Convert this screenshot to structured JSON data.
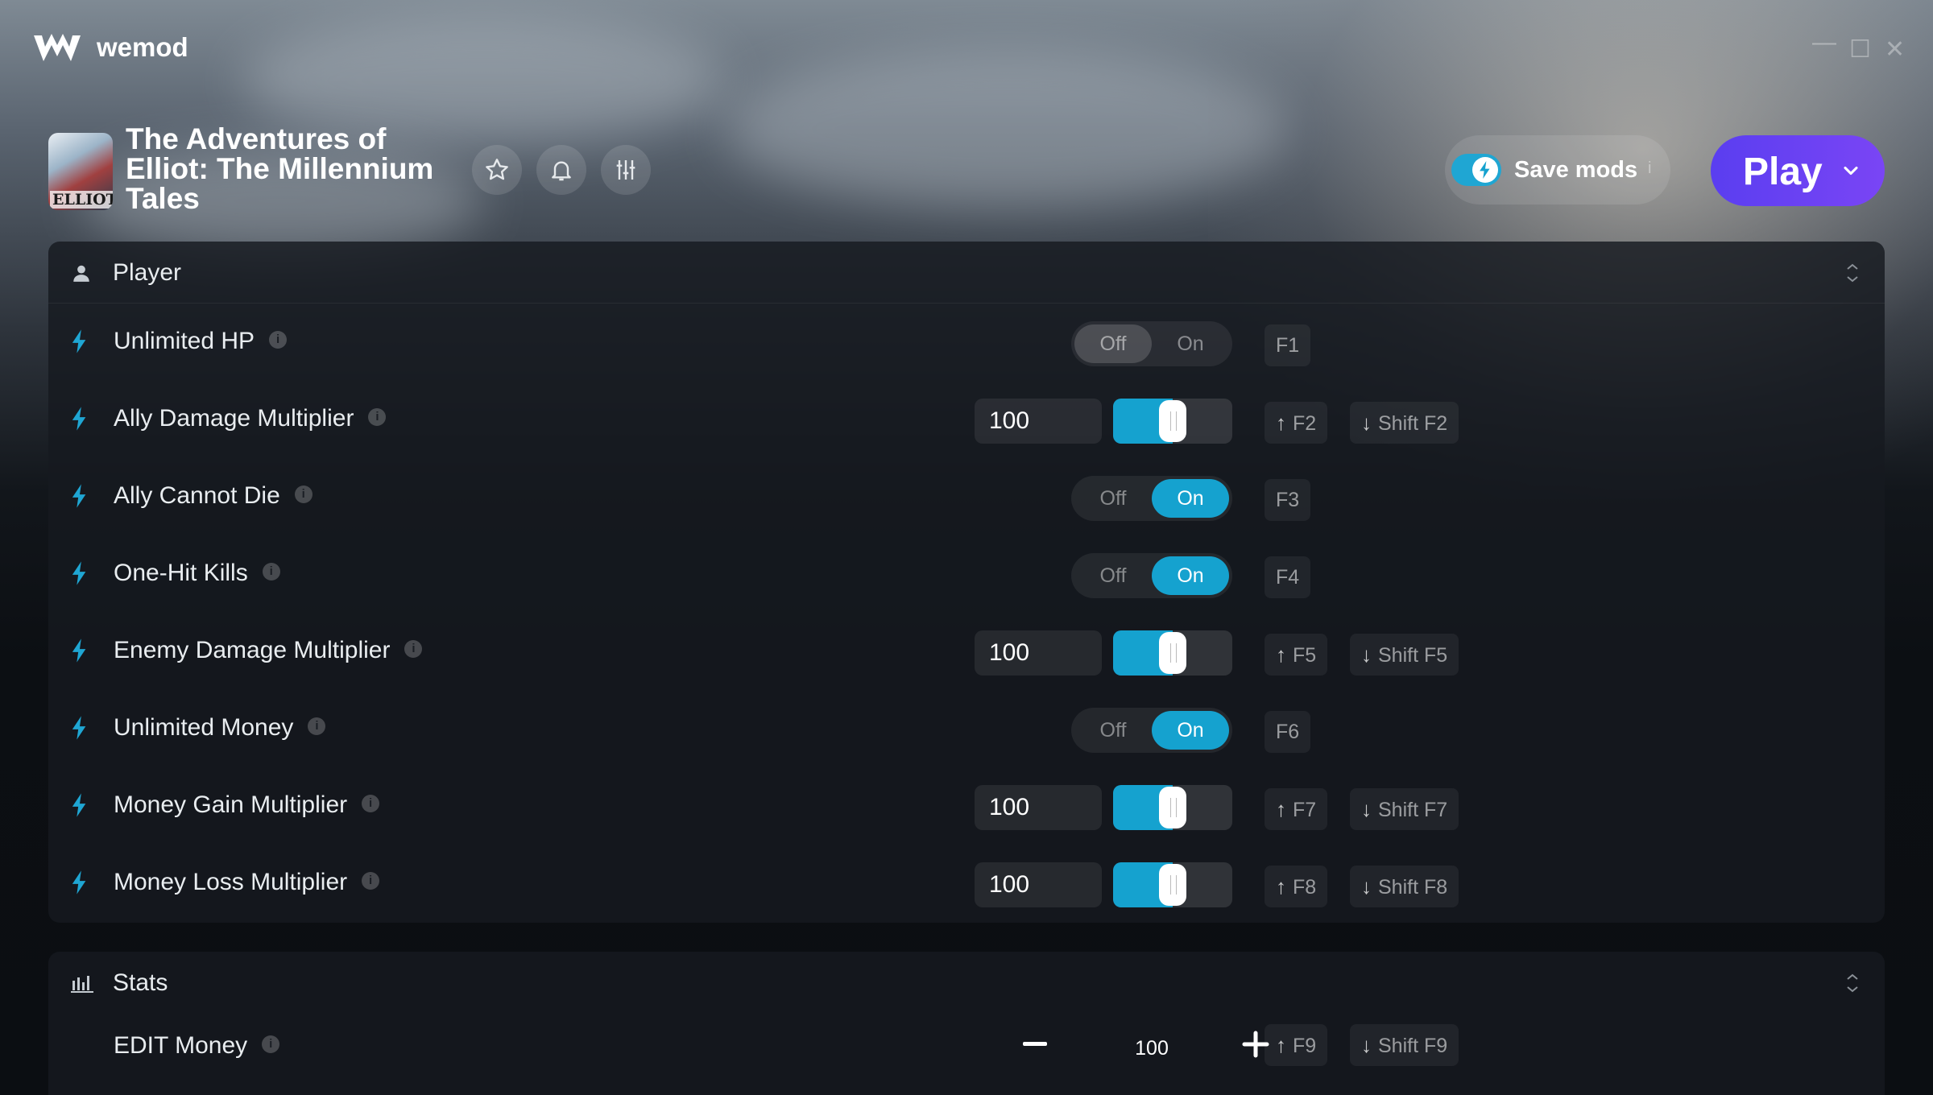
{
  "app": {
    "brand": "wemod"
  },
  "window_controls": {
    "minimize": "—",
    "maximize": "☐",
    "close": "✕"
  },
  "game": {
    "title": "The Adventures of Elliot: The Millennium Tales",
    "cover_text": "ELLIOT"
  },
  "header_actions": {
    "favorite": "star-icon",
    "notify": "bell-icon",
    "settings": "sliders-icon"
  },
  "save_mods": {
    "label": "Save mods",
    "enabled": true,
    "info": "i"
  },
  "play": {
    "label": "Play"
  },
  "sections": [
    {
      "title": "Player",
      "mods": [
        {
          "name": "Unlimited HP",
          "type": "toggle",
          "state": "Off",
          "off_label": "Off",
          "on_label": "On",
          "keys": [
            "F1"
          ]
        },
        {
          "name": "Ally Damage Multiplier",
          "type": "slider",
          "value": "100",
          "fraction": 0.5,
          "inc_key": "F2",
          "dec_key": "Shift F2"
        },
        {
          "name": "Ally Cannot Die",
          "type": "toggle",
          "state": "On",
          "off_label": "Off",
          "on_label": "On",
          "keys": [
            "F3"
          ]
        },
        {
          "name": "One-Hit Kills",
          "type": "toggle",
          "state": "On",
          "off_label": "Off",
          "on_label": "On",
          "keys": [
            "F4"
          ]
        },
        {
          "name": "Enemy Damage Multiplier",
          "type": "slider",
          "value": "100",
          "fraction": 0.5,
          "inc_key": "F5",
          "dec_key": "Shift F5"
        },
        {
          "name": "Unlimited Money",
          "type": "toggle",
          "state": "On",
          "off_label": "Off",
          "on_label": "On",
          "keys": [
            "F6"
          ]
        },
        {
          "name": "Money Gain Multiplier",
          "type": "slider",
          "value": "100",
          "fraction": 0.5,
          "inc_key": "F7",
          "dec_key": "Shift F7"
        },
        {
          "name": "Money Loss Multiplier",
          "type": "slider",
          "value": "100",
          "fraction": 0.5,
          "inc_key": "F8",
          "dec_key": "Shift F8"
        }
      ]
    },
    {
      "title": "Stats",
      "mods": [
        {
          "name": "EDIT Money",
          "type": "stepper",
          "value": "100",
          "inc_key": "F9",
          "dec_key": "Shift F9"
        }
      ]
    }
  ],
  "colors": {
    "accent": "#15a2cf",
    "play": "#6a42f2"
  }
}
